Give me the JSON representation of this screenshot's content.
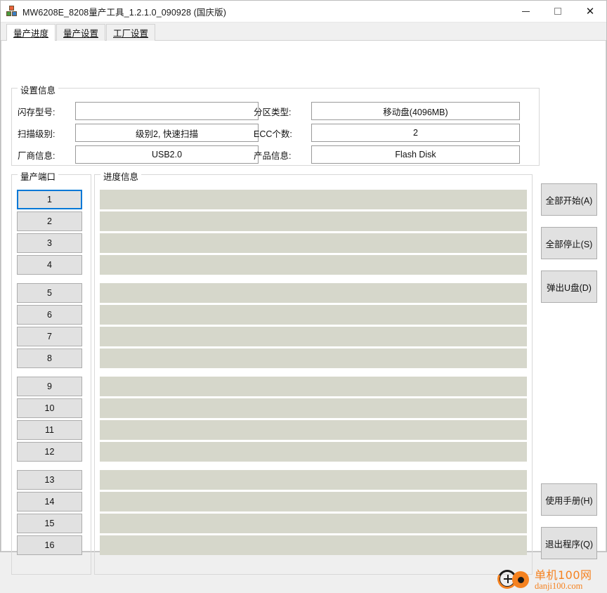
{
  "window": {
    "title": "MW6208E_8208量产工具_1.2.1.0_090928  (国庆版)",
    "icon": "blocks-icon",
    "minimize_label": "—",
    "maximize_label": "□",
    "close_label": "✕"
  },
  "tabs": [
    {
      "label": "量产进度",
      "active": true
    },
    {
      "label": "量产设置",
      "active": false
    },
    {
      "label": "工厂设置",
      "active": false
    }
  ],
  "settings": {
    "title": "设置信息",
    "fields": [
      {
        "label": "闪存型号:",
        "value": ""
      },
      {
        "label": "分区类型:",
        "value": "移动盘(4096MB)"
      },
      {
        "label": "扫描级别:",
        "value": "级别2, 快速扫描"
      },
      {
        "label": "ECC个数:",
        "value": "2"
      },
      {
        "label": "厂商信息:",
        "value": "USB2.0"
      },
      {
        "label": "产品信息:",
        "value": "Flash Disk"
      }
    ]
  },
  "ports": {
    "title": "量产端口",
    "focused_index": 0,
    "items": [
      {
        "label": "1"
      },
      {
        "label": "2"
      },
      {
        "label": "3"
      },
      {
        "label": "4"
      },
      {
        "label": "5"
      },
      {
        "label": "6"
      },
      {
        "label": "7"
      },
      {
        "label": "8"
      },
      {
        "label": "9"
      },
      {
        "label": "10"
      },
      {
        "label": "11"
      },
      {
        "label": "12"
      },
      {
        "label": "13"
      },
      {
        "label": "14"
      },
      {
        "label": "15"
      },
      {
        "label": "16"
      }
    ]
  },
  "progress": {
    "title": "进度信息",
    "bars": [
      {
        "percent": 0,
        "text": ""
      },
      {
        "percent": 0,
        "text": ""
      },
      {
        "percent": 0,
        "text": ""
      },
      {
        "percent": 0,
        "text": ""
      },
      {
        "percent": 0,
        "text": ""
      },
      {
        "percent": 0,
        "text": ""
      },
      {
        "percent": 0,
        "text": ""
      },
      {
        "percent": 0,
        "text": ""
      },
      {
        "percent": 0,
        "text": ""
      },
      {
        "percent": 0,
        "text": ""
      },
      {
        "percent": 0,
        "text": ""
      },
      {
        "percent": 0,
        "text": ""
      },
      {
        "percent": 0,
        "text": ""
      },
      {
        "percent": 0,
        "text": ""
      },
      {
        "percent": 0,
        "text": ""
      },
      {
        "percent": 0,
        "text": ""
      }
    ]
  },
  "actions_top": [
    {
      "label": "全部开始(A)",
      "name": "start-all-button"
    },
    {
      "label": "全部停止(S)",
      "name": "stop-all-button"
    },
    {
      "label": "弹出U盘(D)",
      "name": "eject-usb-button"
    }
  ],
  "actions_bottom": [
    {
      "label": "使用手册(H)",
      "name": "manual-button"
    },
    {
      "label": "退出程序(Q)",
      "name": "quit-button"
    }
  ],
  "watermark": {
    "cn": "单机100网",
    "en": "danji100.com"
  },
  "colors": {
    "accent": "#0078d7",
    "progress_track": "#d6d7cb",
    "button_face": "#e1e1e1",
    "watermark": "#f58220"
  }
}
